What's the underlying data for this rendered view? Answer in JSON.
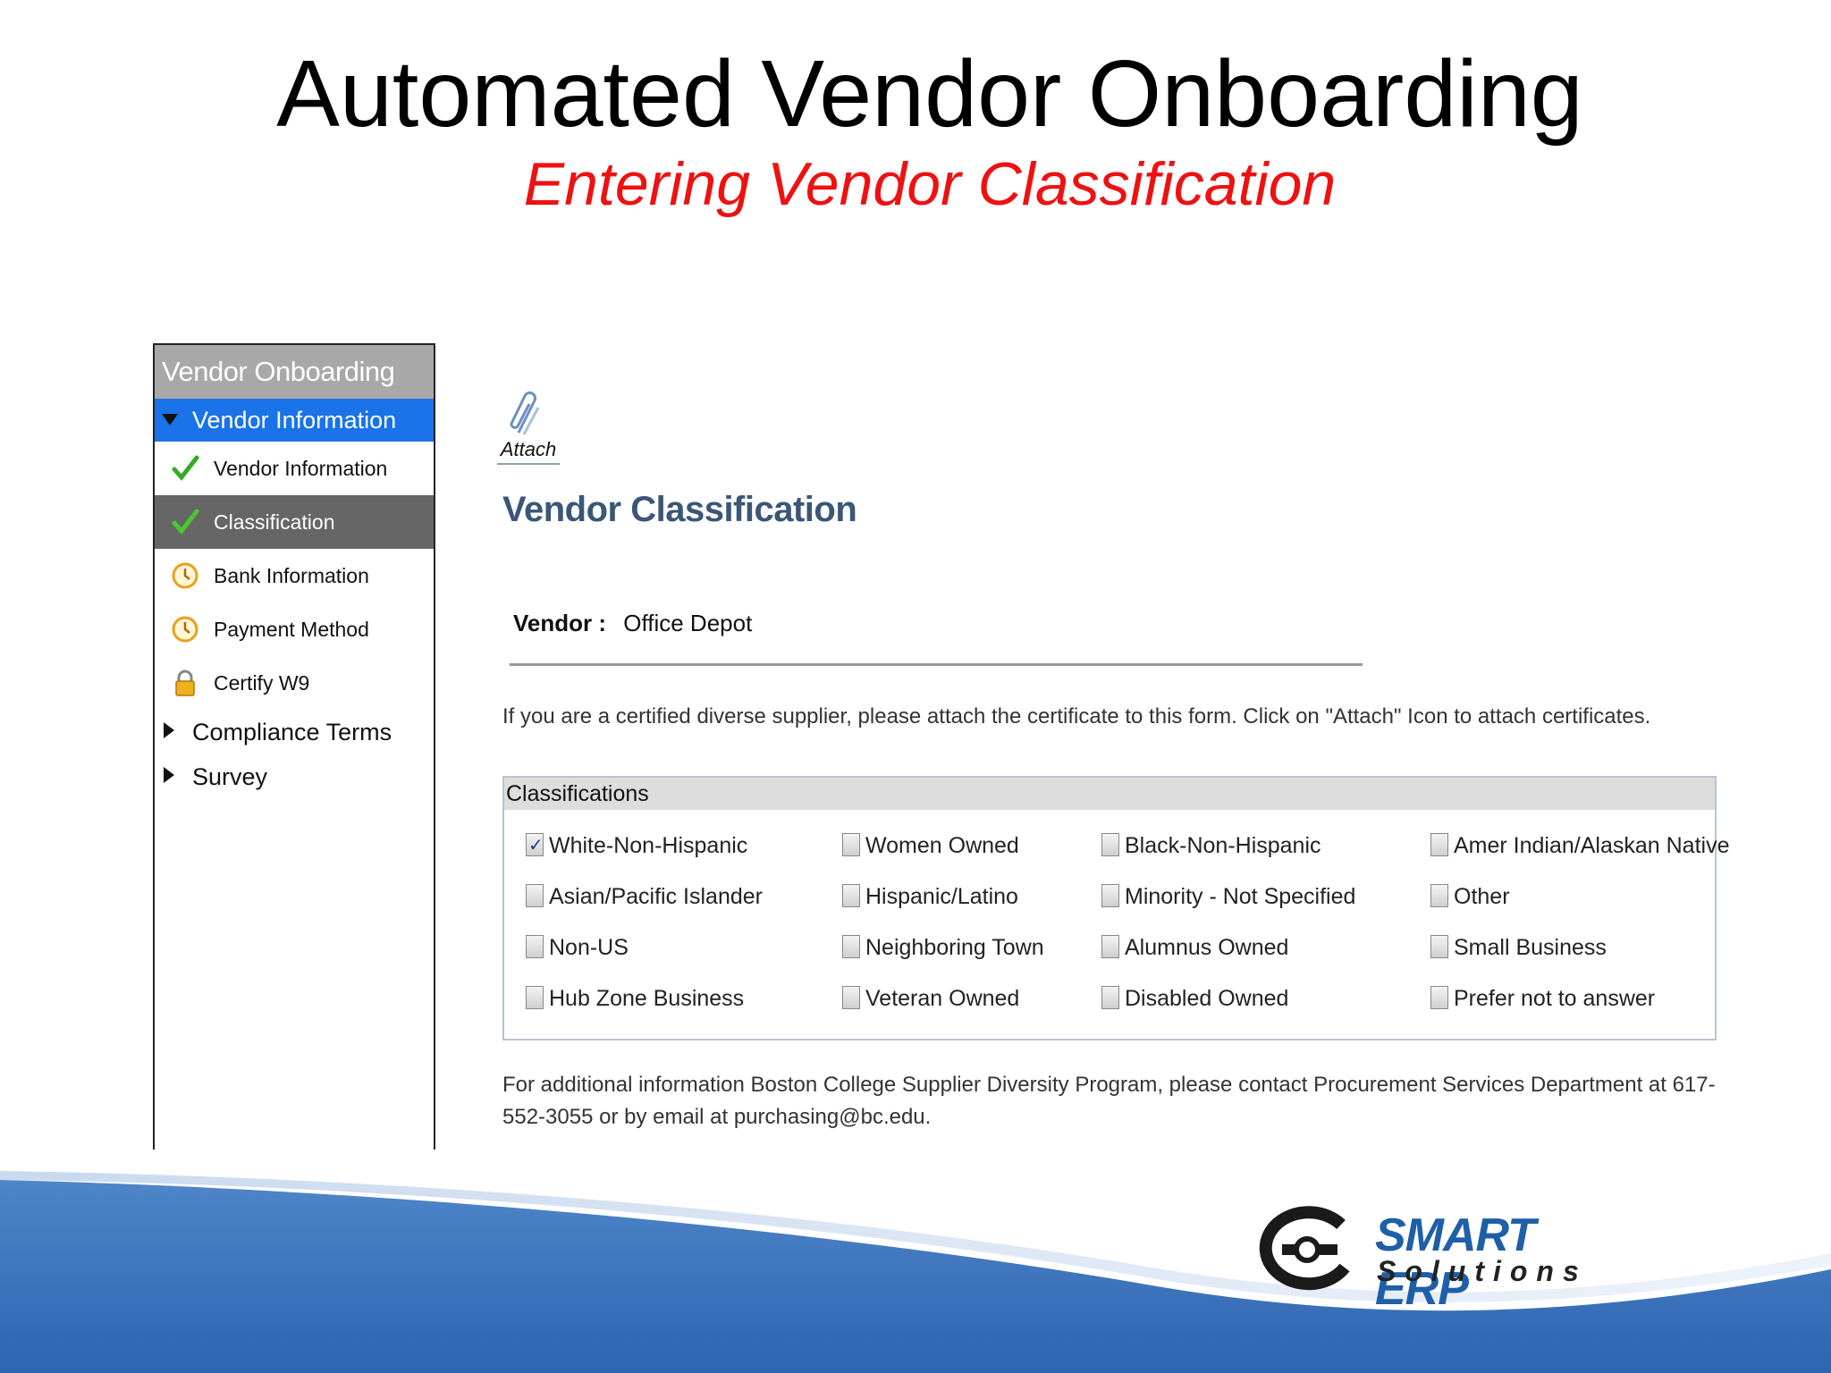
{
  "slide": {
    "title": "Automated Vendor Onboarding",
    "subtitle": "Entering Vendor Classification"
  },
  "nav": {
    "header": "Vendor Onboarding",
    "section": "Vendor Information",
    "items": [
      {
        "label": "Vendor Information",
        "icon": "check-icon",
        "status": "complete"
      },
      {
        "label": "Classification",
        "icon": "check-icon",
        "status": "active"
      },
      {
        "label": "Bank Information",
        "icon": "clock-icon",
        "status": "pending"
      },
      {
        "label": "Payment Method",
        "icon": "clock-icon",
        "status": "pending"
      },
      {
        "label": "Certify W9",
        "icon": "lock-icon",
        "status": "locked"
      }
    ],
    "collapsed": [
      "Compliance Terms",
      "Survey"
    ]
  },
  "attach": {
    "label": "Attach",
    "icon": "paperclip-icon"
  },
  "page": {
    "heading": "Vendor Classification",
    "vendor_label": "Vendor :",
    "vendor_value": "Office Depot",
    "info": "If you are a certified diverse supplier, please attach the certificate to this form. Click on \"Attach\" Icon to attach certificates.",
    "classifications_header": "Classifications",
    "classifications": [
      {
        "label": "White-Non-Hispanic",
        "checked": true
      },
      {
        "label": "Women Owned",
        "checked": false
      },
      {
        "label": "Black-Non-Hispanic",
        "checked": false
      },
      {
        "label": "Amer Indian/Alaskan Native",
        "checked": false
      },
      {
        "label": "Asian/Pacific Islander",
        "checked": false
      },
      {
        "label": "Hispanic/Latino",
        "checked": false
      },
      {
        "label": "Minority - Not Specified",
        "checked": false
      },
      {
        "label": "Other",
        "checked": false
      },
      {
        "label": "Non-US",
        "checked": false
      },
      {
        "label": "Neighboring Town",
        "checked": false
      },
      {
        "label": "Alumnus Owned",
        "checked": false
      },
      {
        "label": "Small Business",
        "checked": false
      },
      {
        "label": "Hub Zone Business",
        "checked": false
      },
      {
        "label": "Veteran Owned",
        "checked": false
      },
      {
        "label": "Disabled Owned",
        "checked": false
      },
      {
        "label": "Prefer not to answer",
        "checked": false
      }
    ],
    "footer": "For additional information Boston College Supplier Diversity Program, please contact Procurement Services Department at 617-552-3055 or by email at purchasing@bc.edu."
  },
  "logo": {
    "line1": "SMART ERP",
    "line2": "Solutions"
  },
  "colors": {
    "accent": "#1a73e8",
    "subtitle": "#ee1111",
    "heading": "#3b5676",
    "brand": "#1e5fa8"
  }
}
